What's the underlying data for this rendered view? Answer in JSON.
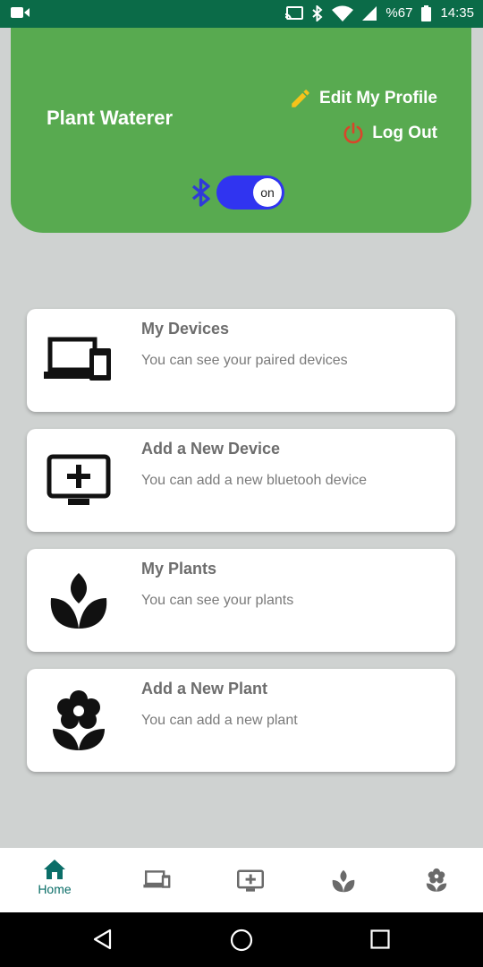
{
  "status_bar": {
    "battery": "%67",
    "time": "14:35",
    "icons": [
      "video-icon",
      "cast-icon",
      "bluetooth-icon",
      "wifi-icon",
      "signal-icon",
      "battery-icon"
    ]
  },
  "header": {
    "app_title": "Plant Waterer",
    "edit_profile": "Edit My Profile",
    "log_out": "Log Out",
    "bluetooth_toggle": "on",
    "colors": {
      "header_bg": "#58aa50",
      "toggle": "#3034f0",
      "pencil": "#f6c31b",
      "power": "#d9452a"
    }
  },
  "cards": [
    {
      "title": "My Devices",
      "desc": "You can see your paired devices",
      "icon": "devices-icon"
    },
    {
      "title": "Add a New Device",
      "desc": "You can add a new bluetooh device",
      "icon": "add-device-icon"
    },
    {
      "title": "My Plants",
      "desc": "You can see your plants",
      "icon": "plant-icon"
    },
    {
      "title": "Add a New Plant",
      "desc": "You can add a new plant",
      "icon": "flower-icon"
    }
  ],
  "bottom_nav": {
    "items": [
      {
        "label": "Home",
        "icon": "home-icon",
        "active": true
      },
      {
        "icon": "devices-icon"
      },
      {
        "icon": "add-device-icon"
      },
      {
        "icon": "plant-icon"
      },
      {
        "icon": "flower-icon"
      }
    ],
    "active_color": "#0b6e68"
  }
}
